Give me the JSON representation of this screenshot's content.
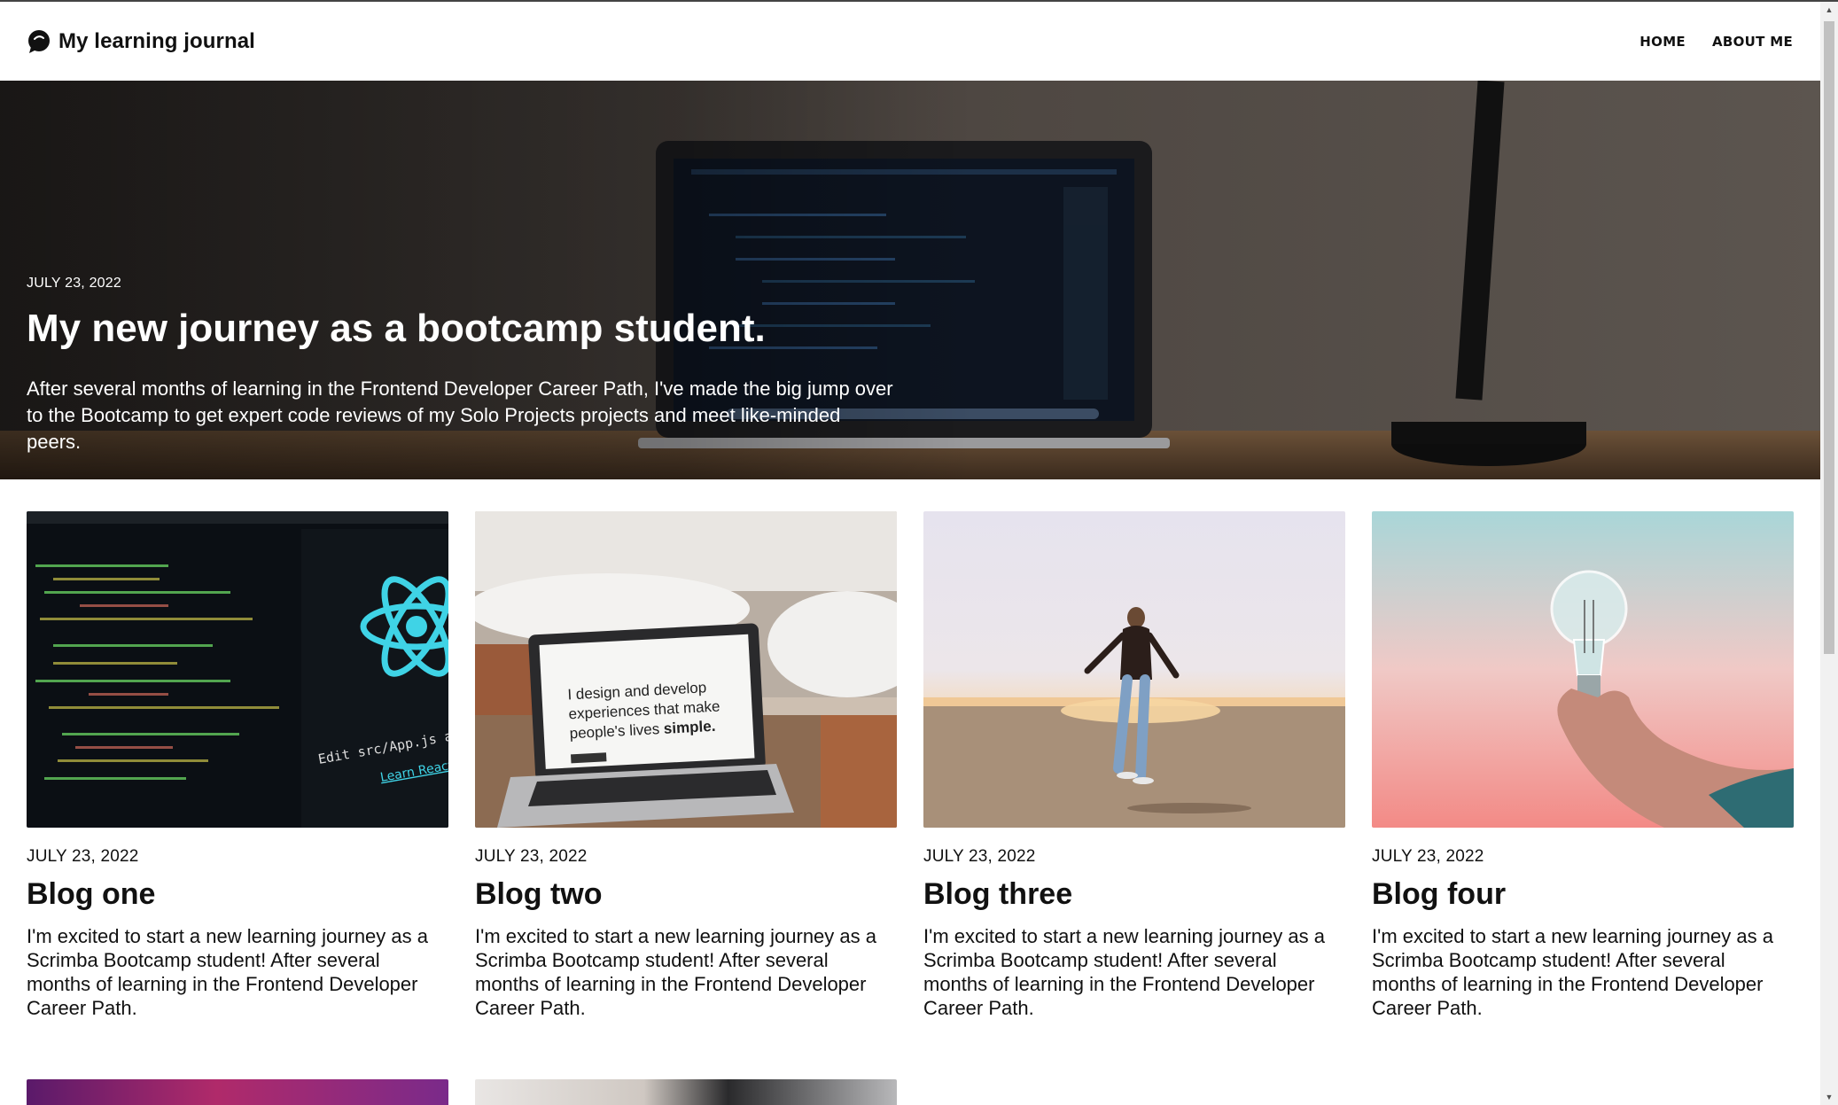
{
  "header": {
    "brand_name": "My learning journal",
    "nav": {
      "home": "HOME",
      "about": "ABOUT ME"
    }
  },
  "hero": {
    "date": "JULY 23, 2022",
    "title": "My new journey as a bootcamp student.",
    "text": "After several months of learning in the Frontend Developer Career Path, I've made the big jump over to the Bootcamp to get expert code reviews of my Solo Projects projects and meet like-minded peers."
  },
  "posts": [
    {
      "date": "JULY 23, 2022",
      "title": "Blog one",
      "text": "I'm excited to start a new learning journey as a Scrimba Bootcamp student! After several months of learning in the Frontend Developer Career Path.",
      "image": {
        "caption_line1": "Edit src/App.js and save",
        "caption_line2": "Learn React"
      }
    },
    {
      "date": "JULY 23, 2022",
      "title": "Blog two",
      "text": "I'm excited to start a new learning journey as a Scrimba Bootcamp student! After several months of learning in the Frontend Developer Career Path.",
      "image": {
        "line1": "I design and develop",
        "line2": "experiences that make",
        "line3": "people's lives ",
        "line3_bold": "simple."
      }
    },
    {
      "date": "JULY 23, 2022",
      "title": "Blog three",
      "text": "I'm excited to start a new learning journey as a Scrimba Bootcamp student! After several months of learning in the Frontend Developer Career Path."
    },
    {
      "date": "JULY 23, 2022",
      "title": "Blog four",
      "text": "I'm excited to start a new learning journey as a Scrimba Bootcamp student! After several months of learning in the Frontend Developer Career Path."
    }
  ],
  "colors": {
    "text": "#111111",
    "hero_text": "#ffffff",
    "react_cyan": "#3fd3e6"
  }
}
